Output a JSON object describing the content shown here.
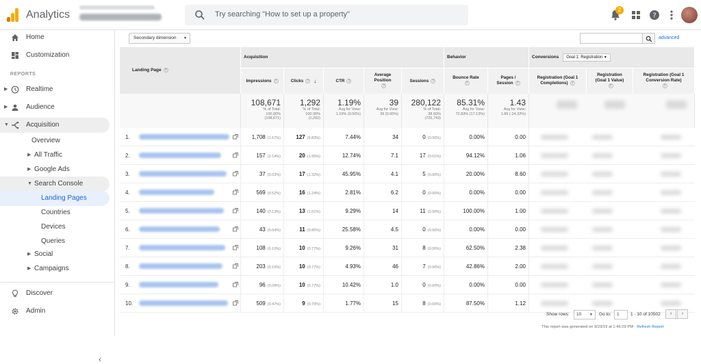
{
  "app": {
    "title": "Analytics"
  },
  "search": {
    "placeholder": "Try searching \"How to set up a property\""
  },
  "notifications": {
    "count": "2"
  },
  "sidebar": {
    "home": "Home",
    "customization": "Customization",
    "reports_label": "REPORTS",
    "realtime": "Realtime",
    "audience": "Audience",
    "acquisition": "Acquisition",
    "overview": "Overview",
    "all_traffic": "All Traffic",
    "google_ads": "Google Ads",
    "search_console": "Search Console",
    "landing_pages": "Landing Pages",
    "countries": "Countries",
    "devices": "Devices",
    "queries": "Queries",
    "social": "Social",
    "campaigns": "Campaigns",
    "discover": "Discover",
    "admin": "Admin",
    "collapse": "‹"
  },
  "toolbar": {
    "secondary_dimension": "Secondary dimension",
    "advanced": "advanced"
  },
  "table": {
    "landing_page_header": "Landing Page",
    "groups": {
      "acquisition": "Acquisition",
      "behavior": "Behavior",
      "conversions": "Conversions",
      "goal_select": "Goal 1: Registration"
    },
    "columns": {
      "impressions": "Impressions",
      "clicks": "Clicks",
      "ctr": "CTR",
      "avg_position_1": "Average",
      "avg_position_2": "Position",
      "sessions": "Sessions",
      "bounce_rate": "Bounce Rate",
      "pages_session_1": "Pages /",
      "pages_session_2": "Session",
      "reg_completions_1": "Registration (Goal 1",
      "reg_completions_2": "Completions)",
      "reg_value_1": "Registration",
      "reg_value_2": "(Goal 1 Value)",
      "reg_rate_1": "Registration (Goal 1",
      "reg_rate_2": "Conversion Rate)"
    },
    "totals": {
      "impressions": {
        "big": "108,671",
        "l1": "% of Total:",
        "l2": "100.00%",
        "l3": "(108,671)"
      },
      "clicks": {
        "big": "1,292",
        "l1": "% of Total:",
        "l2": "100.00%",
        "l3": "(1,292)"
      },
      "ctr": {
        "big": "1.19%",
        "l1": "Avg for View:",
        "l2": "1.19% (0.00%)"
      },
      "avg_position": {
        "big": "39",
        "l1": "Avg for View:",
        "l2": "39 (0.00%)"
      },
      "sessions": {
        "big": "280,122",
        "l1": "% of Total:",
        "l2": "38.60%",
        "l3": "(725,743)"
      },
      "bounce_rate": {
        "big": "85.31%",
        "l1": "Avg for View:",
        "l2": "72.83% (17.13%)"
      },
      "pages_session": {
        "big": "1.43",
        "l1": "Avg for View:",
        "l2": "1.89 (-24.32%)"
      }
    },
    "rows": [
      {
        "n": "1.",
        "imp": "1,708",
        "imp_pct": "(1.57%)",
        "clicks": "127",
        "clicks_pct": "(9.83%)",
        "ctr": "7.44%",
        "pos": "34",
        "sess": "0",
        "sess_pct": "(0.00%)",
        "bounce": "0.00%",
        "pps": "0.00"
      },
      {
        "n": "2.",
        "imp": "157",
        "imp_pct": "(0.14%)",
        "clicks": "20",
        "clicks_pct": "(1.55%)",
        "ctr": "12.74%",
        "pos": "7.1",
        "sess": "17",
        "sess_pct": "(0.01%)",
        "bounce": "94.12%",
        "pps": "1.06"
      },
      {
        "n": "3.",
        "imp": "37",
        "imp_pct": "(0.03%)",
        "clicks": "17",
        "clicks_pct": "(1.32%)",
        "ctr": "45.95%",
        "pos": "4.1",
        "sess": "5",
        "sess_pct": "(0.00%)",
        "bounce": "20.00%",
        "pps": "8.60"
      },
      {
        "n": "4.",
        "imp": "569",
        "imp_pct": "(0.52%)",
        "clicks": "16",
        "clicks_pct": "(1.24%)",
        "ctr": "2.81%",
        "pos": "6.2",
        "sess": "0",
        "sess_pct": "(0.00%)",
        "bounce": "0.00%",
        "pps": "0.00"
      },
      {
        "n": "5.",
        "imp": "140",
        "imp_pct": "(0.13%)",
        "clicks": "13",
        "clicks_pct": "(1.01%)",
        "ctr": "9.29%",
        "pos": "14",
        "sess": "11",
        "sess_pct": "(0.00%)",
        "bounce": "100.00%",
        "pps": "1.00"
      },
      {
        "n": "6.",
        "imp": "43",
        "imp_pct": "(0.04%)",
        "clicks": "11",
        "clicks_pct": "(0.85%)",
        "ctr": "25.58%",
        "pos": "4.5",
        "sess": "0",
        "sess_pct": "(0.00%)",
        "bounce": "0.00%",
        "pps": "0.00"
      },
      {
        "n": "7.",
        "imp": "108",
        "imp_pct": "(0.10%)",
        "clicks": "10",
        "clicks_pct": "(0.77%)",
        "ctr": "9.26%",
        "pos": "31",
        "sess": "8",
        "sess_pct": "(0.00%)",
        "bounce": "62.50%",
        "pps": "2.38"
      },
      {
        "n": "8.",
        "imp": "203",
        "imp_pct": "(0.19%)",
        "clicks": "10",
        "clicks_pct": "(0.77%)",
        "ctr": "4.93%",
        "pos": "46",
        "sess": "7",
        "sess_pct": "(0.00%)",
        "bounce": "42.86%",
        "pps": "2.00"
      },
      {
        "n": "9.",
        "imp": "96",
        "imp_pct": "(0.09%)",
        "clicks": "10",
        "clicks_pct": "(0.77%)",
        "ctr": "10.42%",
        "pos": "1.0",
        "sess": "0",
        "sess_pct": "(0.00%)",
        "bounce": "0.00%",
        "pps": "0.00"
      },
      {
        "n": "10.",
        "imp": "509",
        "imp_pct": "(0.47%)",
        "clicks": "9",
        "clicks_pct": "(0.70%)",
        "ctr": "1.77%",
        "pos": "15",
        "sess": "8",
        "sess_pct": "(0.00%)",
        "bounce": "87.50%",
        "pps": "1.12"
      }
    ]
  },
  "pagination": {
    "show_rows_label": "Show rows:",
    "show_rows_value": "10",
    "goto_label": "Go to:",
    "goto_value": "1",
    "range": "1 - 10 of 10502",
    "prev": "‹",
    "next": "›"
  },
  "report_note": {
    "text": "This report was generated on 9/23/19 at 1:46:29 PM · ",
    "refresh": "Refresh Report"
  },
  "colors": {
    "accent_blue": "#1a73e8",
    "active_bg": "#e8f0fe",
    "header_bg": "#e9e9e9",
    "badge": "#f9ab00"
  }
}
